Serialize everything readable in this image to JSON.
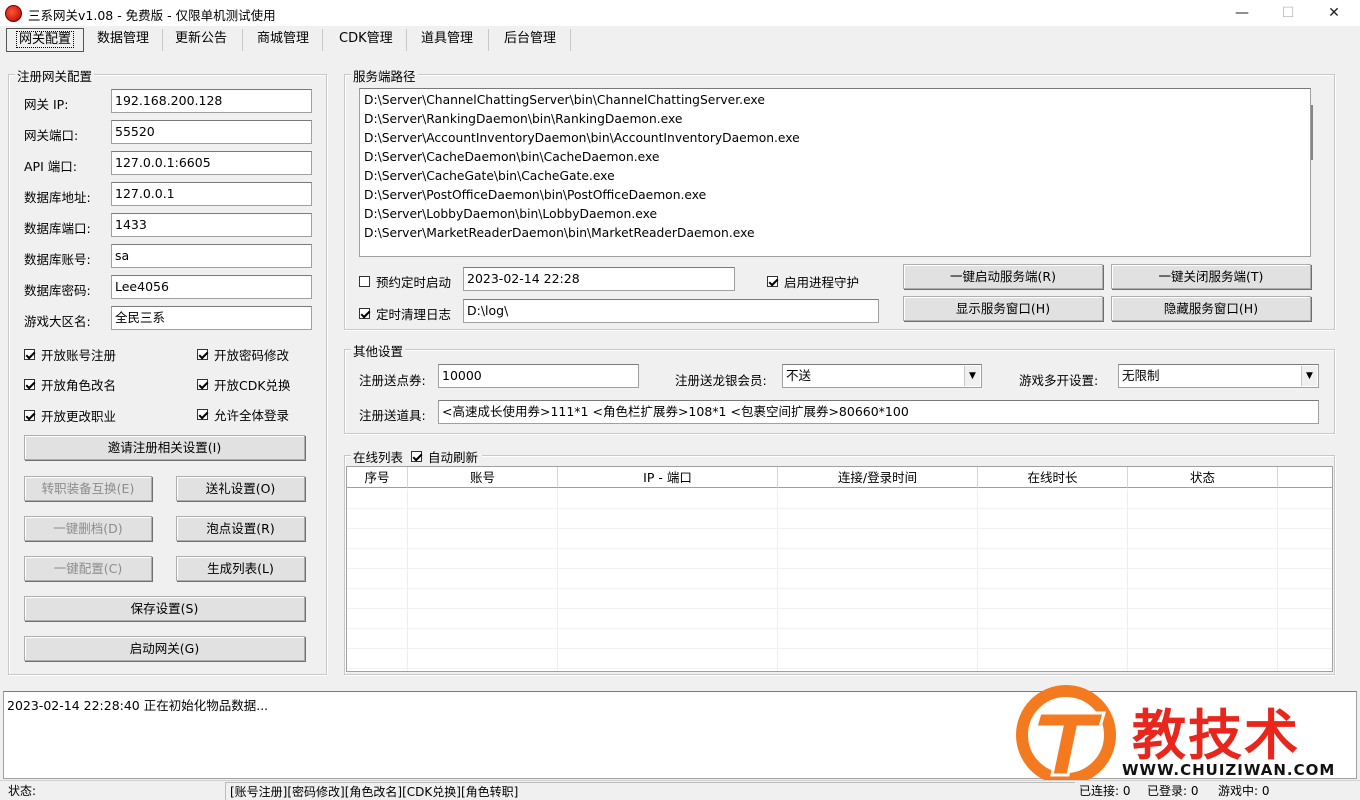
{
  "window": {
    "title": "三系网关v1.08 - 免费版 - 仅限单机测试使用",
    "minimize": "—",
    "maximize": "☐",
    "close": "✕"
  },
  "tabs": [
    "网关配置",
    "数据管理",
    "更新公告",
    "商城管理",
    "CDK管理",
    "道具管理",
    "后台管理"
  ],
  "register_group": {
    "title": "注册网关配置",
    "fields": [
      {
        "label": "网关 IP:",
        "value": "192.168.200.128"
      },
      {
        "label": "网关端口:",
        "value": "55520"
      },
      {
        "label": "API 端口:",
        "value": "127.0.0.1:6605"
      },
      {
        "label": "数据库地址:",
        "value": "127.0.0.1"
      },
      {
        "label": "数据库端口:",
        "value": "1433"
      },
      {
        "label": "数据库账号:",
        "value": "sa"
      },
      {
        "label": "数据库密码:",
        "value": "Lee4056"
      },
      {
        "label": "游戏大区名:",
        "value": "全民三系"
      }
    ],
    "checks": [
      {
        "label": "开放账号注册",
        "checked": true
      },
      {
        "label": "开放密码修改",
        "checked": true
      },
      {
        "label": "开放角色改名",
        "checked": true
      },
      {
        "label": "开放CDK兑换",
        "checked": true
      },
      {
        "label": "开放更改职业",
        "checked": true
      },
      {
        "label": "允许全体登录",
        "checked": true
      }
    ],
    "invite_btn": "邀请注册相关设置(I)",
    "job_swap_btn": "转职装备互换(E)",
    "gift_btn": "送礼设置(O)",
    "delete_btn": "一键删档(D)",
    "bubble_btn": "泡点设置(R)",
    "config_btn": "一键配置(C)",
    "gen_list_btn": "生成列表(L)",
    "save_btn": "保存设置(S)",
    "start_btn": "启动网关(G)"
  },
  "server_group": {
    "title": "服务端路径",
    "paths": [
      "D:\\Server\\ChannelChattingServer\\bin\\ChannelChattingServer.exe",
      "D:\\Server\\RankingDaemon\\bin\\RankingDaemon.exe",
      "D:\\Server\\AccountInventoryDaemon\\bin\\AccountInventoryDaemon.exe",
      "D:\\Server\\CacheDaemon\\bin\\CacheDaemon.exe",
      "D:\\Server\\CacheGate\\bin\\CacheGate.exe",
      "D:\\Server\\PostOfficeDaemon\\bin\\PostOfficeDaemon.exe",
      "D:\\Server\\LobbyDaemon\\bin\\LobbyDaemon.exe",
      "D:\\Server\\MarketReaderDaemon\\bin\\MarketReaderDaemon.exe"
    ],
    "schedule_label": "预约定时启动",
    "schedule_checked": false,
    "schedule_time": "2023-02-14 22:28",
    "guard_label": "启用进程守护",
    "guard_checked": true,
    "clean_label": "定时清理日志",
    "clean_checked": true,
    "log_path": "D:\\log\\",
    "start_all_btn": "一键启动服务端(R)",
    "stop_all_btn": "一键关闭服务端(T)",
    "show_btn": "显示服务窗口(H)",
    "hide_btn": "隐藏服务窗口(H)"
  },
  "other_group": {
    "title": "其他设置",
    "points_label": "注册送点券:",
    "points_value": "10000",
    "vip_label": "注册送龙银会员:",
    "vip_value": "不送",
    "multi_label": "游戏多开设置:",
    "multi_value": "无限制",
    "items_label": "注册送道具:",
    "items_value": "<高速成长使用券>111*1 <角色栏扩展券>108*1 <包裹空间扩展券>80660*100"
  },
  "online_group": {
    "title": "在线列表",
    "auto_refresh_label": "自动刷新",
    "auto_refresh_checked": true,
    "columns": [
      "序号",
      "账号",
      "IP - 端口",
      "连接/登录时间",
      "在线时长",
      "状态"
    ]
  },
  "log": {
    "lines": [
      "2023-02-14 22:28:40  正在初始化物品数据..."
    ]
  },
  "statusbar": {
    "status": "状态:",
    "features": "[账号注册][密码修改][角色改名][CDK兑换][角色转职]",
    "connected": "已连接:  0",
    "logged_in": "已登录:  0",
    "in_game": "游戏中:  0"
  },
  "watermark": {
    "brand": "教技术",
    "url": "WWW.CHUIZIWAN.COM",
    "colors": {
      "orange": "#f47a20",
      "red": "#e8261c"
    }
  }
}
